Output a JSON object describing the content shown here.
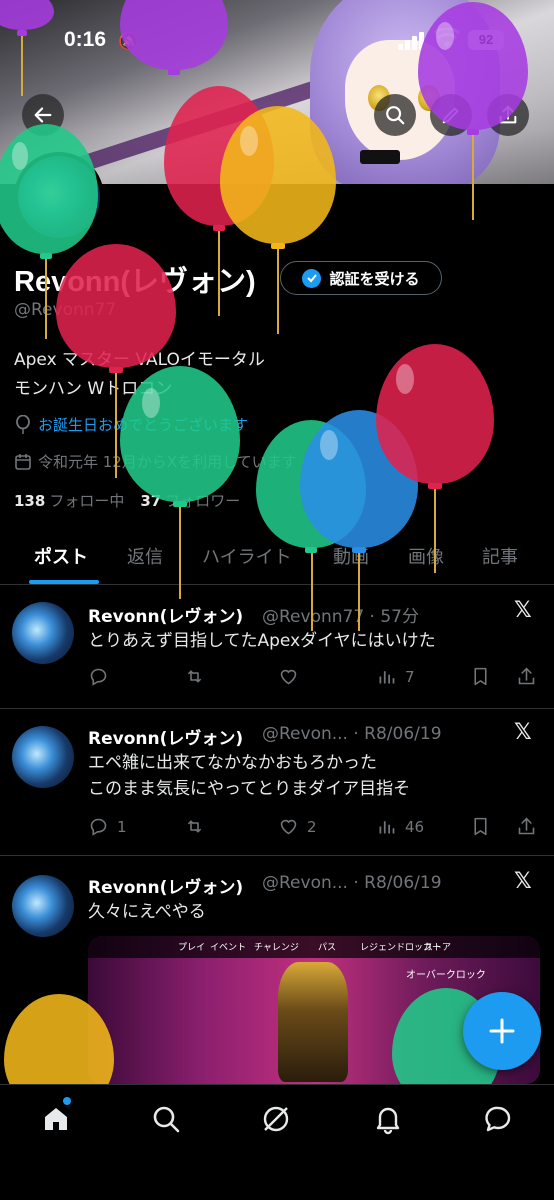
{
  "status_bar": {
    "time": "0:16",
    "battery": "92"
  },
  "profile": {
    "name": "Revonn(レヴォン)",
    "verify_button": "認証を受ける",
    "handle": "@Revonn77",
    "bio_line1": "Apex マスター VALOイモータル",
    "bio_line2": "モンハン Wトロコン",
    "birthday": "お誕生日おめでとうございます",
    "joined": "令和元年 12月からXを利用しています",
    "following_count": "138",
    "following_label": "フォロー中",
    "followers_count": "37",
    "followers_label": "フォロワー"
  },
  "tabs": [
    {
      "label": "ポスト"
    },
    {
      "label": "返信"
    },
    {
      "label": "ハイライト"
    },
    {
      "label": "動画"
    },
    {
      "label": "画像"
    },
    {
      "label": "記事"
    }
  ],
  "posts": [
    {
      "name": "Revonn(レヴォン)",
      "handle_time": "@Revonn77 · 57分",
      "text": "とりあえず目指してたApexダイヤにはいけた",
      "replies": "",
      "reposts": "",
      "likes": "",
      "views": "7"
    },
    {
      "name": "Revonn(レヴォン)",
      "handle_time": "@Revon... · R8/06/19",
      "text": "エペ雑に出来てなかなかおもろかった\nこのまま気長にやってとりまダイア目指そ",
      "replies": "1",
      "reposts": "",
      "likes": "2",
      "views": "46"
    },
    {
      "name": "Revonn(レヴォン)",
      "handle_time": "@Revon... · R8/06/19",
      "text": "久々にえぺやる",
      "media_hud": [
        "プレイ",
        "イベント",
        "チャレンジ",
        "パス",
        "レジェンドロッカー",
        "ストア"
      ],
      "media_caption": "オーバークロック"
    }
  ],
  "colors": {
    "accent": "#1d9bf0",
    "background": "#000000",
    "muted": "#71767b",
    "balloons": [
      "#a63be0",
      "#e0224f",
      "#f2b81a",
      "#21c98a",
      "#2a8ee6"
    ]
  },
  "icons": [
    "back-arrow-icon",
    "search-icon",
    "pencil-icon",
    "share-icon",
    "verified-badge-icon",
    "balloon-icon",
    "calendar-icon",
    "reply-icon",
    "repost-icon",
    "like-icon",
    "views-icon",
    "bookmark-icon",
    "x-logo-icon",
    "plus-icon",
    "home-icon",
    "grok-icon",
    "bell-icon",
    "messages-icon"
  ]
}
